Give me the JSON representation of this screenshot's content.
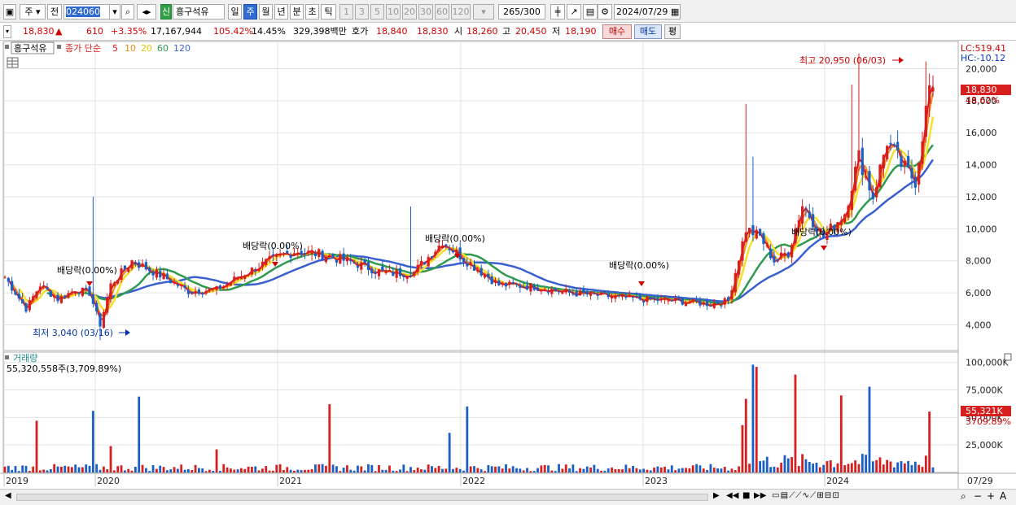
{
  "toolbar": {
    "period_select": "주",
    "prev_button": "전",
    "stock_code": "024060",
    "badge": "신",
    "stock_name": "흥구석유",
    "period_tabs": [
      "일",
      "주",
      "월",
      "년",
      "분",
      "초",
      "틱"
    ],
    "active_tab": "주",
    "interval_buttons": [
      "1",
      "3",
      "5",
      "10",
      "20",
      "30",
      "60",
      "120"
    ],
    "count_current": "265",
    "count_total": "/300",
    "date": "2024/07/29"
  },
  "quote": {
    "price": "18,830",
    "change": "610",
    "change_pct": "+3.35%",
    "volume": "17,167,944",
    "volume_ratio": "105.42%",
    "turnover": "14.45%",
    "amount": "329,398백만",
    "bid_label": "호가",
    "ask": "18,840",
    "bid": "18,830",
    "open_label": "시",
    "open": "18,260",
    "high_label": "고",
    "high": "20,450",
    "low_label": "저",
    "low": "18,190",
    "buy_label": "매수",
    "sell_label": "매도",
    "flat_label": "평"
  },
  "price_panel": {
    "stock_name": "흥구석유",
    "ma_label": "종가 단순",
    "ma_periods": [
      "5",
      "10",
      "20",
      "60",
      "120"
    ],
    "lc_label": "LC:519.41",
    "hc_label": "HC:-10.12",
    "current_price": "18,830",
    "current_pct": "48.62%",
    "high_annotation": "최고 20,950 (06/03)",
    "low_annotation": "최저 3,040 (03/16)",
    "dividend_label": "배당락(0.00%)"
  },
  "volume_panel": {
    "title": "거래량",
    "value_text": "55,320,558주(3,709.89%)",
    "current_volume": "55,321K",
    "current_pct": "3709.89%"
  },
  "colors": {
    "up": "#d61f1f",
    "down": "#1a5fc7",
    "ma5": "#e21b1b",
    "ma10": "#f08a1a",
    "ma20": "#f4e02a",
    "ma60": "#2e9a4e",
    "ma120": "#3a5fd0"
  },
  "chart_data": {
    "type": "candlestick",
    "x_tick_labels": [
      "2019",
      "2020",
      "2021",
      "2022",
      "2023",
      "2024"
    ],
    "x_end_label": "07/29",
    "price_axis": {
      "ticks": [
        4000,
        6000,
        8000,
        10000,
        12000,
        14000,
        16000,
        18000,
        20000
      ],
      "labels": [
        "4,000",
        "6,000",
        "8,000",
        "10,000",
        "12,000",
        "14,000",
        "16,000",
        "18,000",
        "20,000"
      ],
      "ylim": [
        2400,
        21700
      ]
    },
    "volume_axis": {
      "ticks": [
        25000,
        50000,
        75000,
        100000
      ],
      "labels": [
        "25,000K",
        "50,000K",
        "75,000K",
        "100,000K"
      ],
      "ylim": [
        0,
        102000
      ]
    },
    "series_names": [
      "5",
      "10",
      "20",
      "60",
      "120"
    ],
    "price_anchors": [
      [
        0,
        7000
      ],
      [
        6,
        5000
      ],
      [
        10,
        6500
      ],
      [
        15,
        5600
      ],
      [
        20,
        6200
      ],
      [
        24,
        6000
      ],
      [
        27,
        4000
      ],
      [
        30,
        6500
      ],
      [
        36,
        8000
      ],
      [
        45,
        7000
      ],
      [
        52,
        6100
      ],
      [
        60,
        6200
      ],
      [
        68,
        7200
      ],
      [
        75,
        8000
      ],
      [
        82,
        8600
      ],
      [
        90,
        8400
      ],
      [
        100,
        7800
      ],
      [
        108,
        7200
      ],
      [
        116,
        7300
      ],
      [
        124,
        9200
      ],
      [
        132,
        7800
      ],
      [
        140,
        6500
      ],
      [
        150,
        6400
      ],
      [
        160,
        6000
      ],
      [
        170,
        5800
      ],
      [
        180,
        5600
      ],
      [
        190,
        5500
      ],
      [
        200,
        5300
      ],
      [
        205,
        5500
      ],
      [
        210,
        10000
      ],
      [
        214,
        9500
      ],
      [
        218,
        8000
      ],
      [
        222,
        8500
      ],
      [
        226,
        11500
      ],
      [
        232,
        9500
      ],
      [
        238,
        11000
      ],
      [
        242,
        14500
      ],
      [
        246,
        12000
      ],
      [
        250,
        15500
      ],
      [
        254,
        14000
      ],
      [
        258,
        13000
      ],
      [
        262,
        18830
      ]
    ],
    "spikes": [
      [
        5,
        6000,
        "v"
      ],
      [
        25,
        12000,
        "^"
      ],
      [
        115,
        11400,
        "^"
      ],
      [
        210,
        17800,
        "^"
      ],
      [
        212,
        14500,
        "^"
      ],
      [
        240,
        19000,
        "^"
      ],
      [
        242,
        20950,
        "^"
      ],
      [
        261,
        20450,
        "^"
      ],
      [
        27,
        3040,
        "v"
      ]
    ],
    "volume_spikes": [
      [
        9,
        47000
      ],
      [
        25,
        56000
      ],
      [
        30,
        24000
      ],
      [
        38,
        69000
      ],
      [
        60,
        21000
      ],
      [
        92,
        62000
      ],
      [
        126,
        36000
      ],
      [
        131,
        60000
      ],
      [
        209,
        43000
      ],
      [
        210,
        67000
      ],
      [
        212,
        98000
      ],
      [
        213,
        96000
      ],
      [
        224,
        89000
      ],
      [
        237,
        70000
      ],
      [
        245,
        78000
      ],
      [
        262,
        55321
      ]
    ]
  }
}
